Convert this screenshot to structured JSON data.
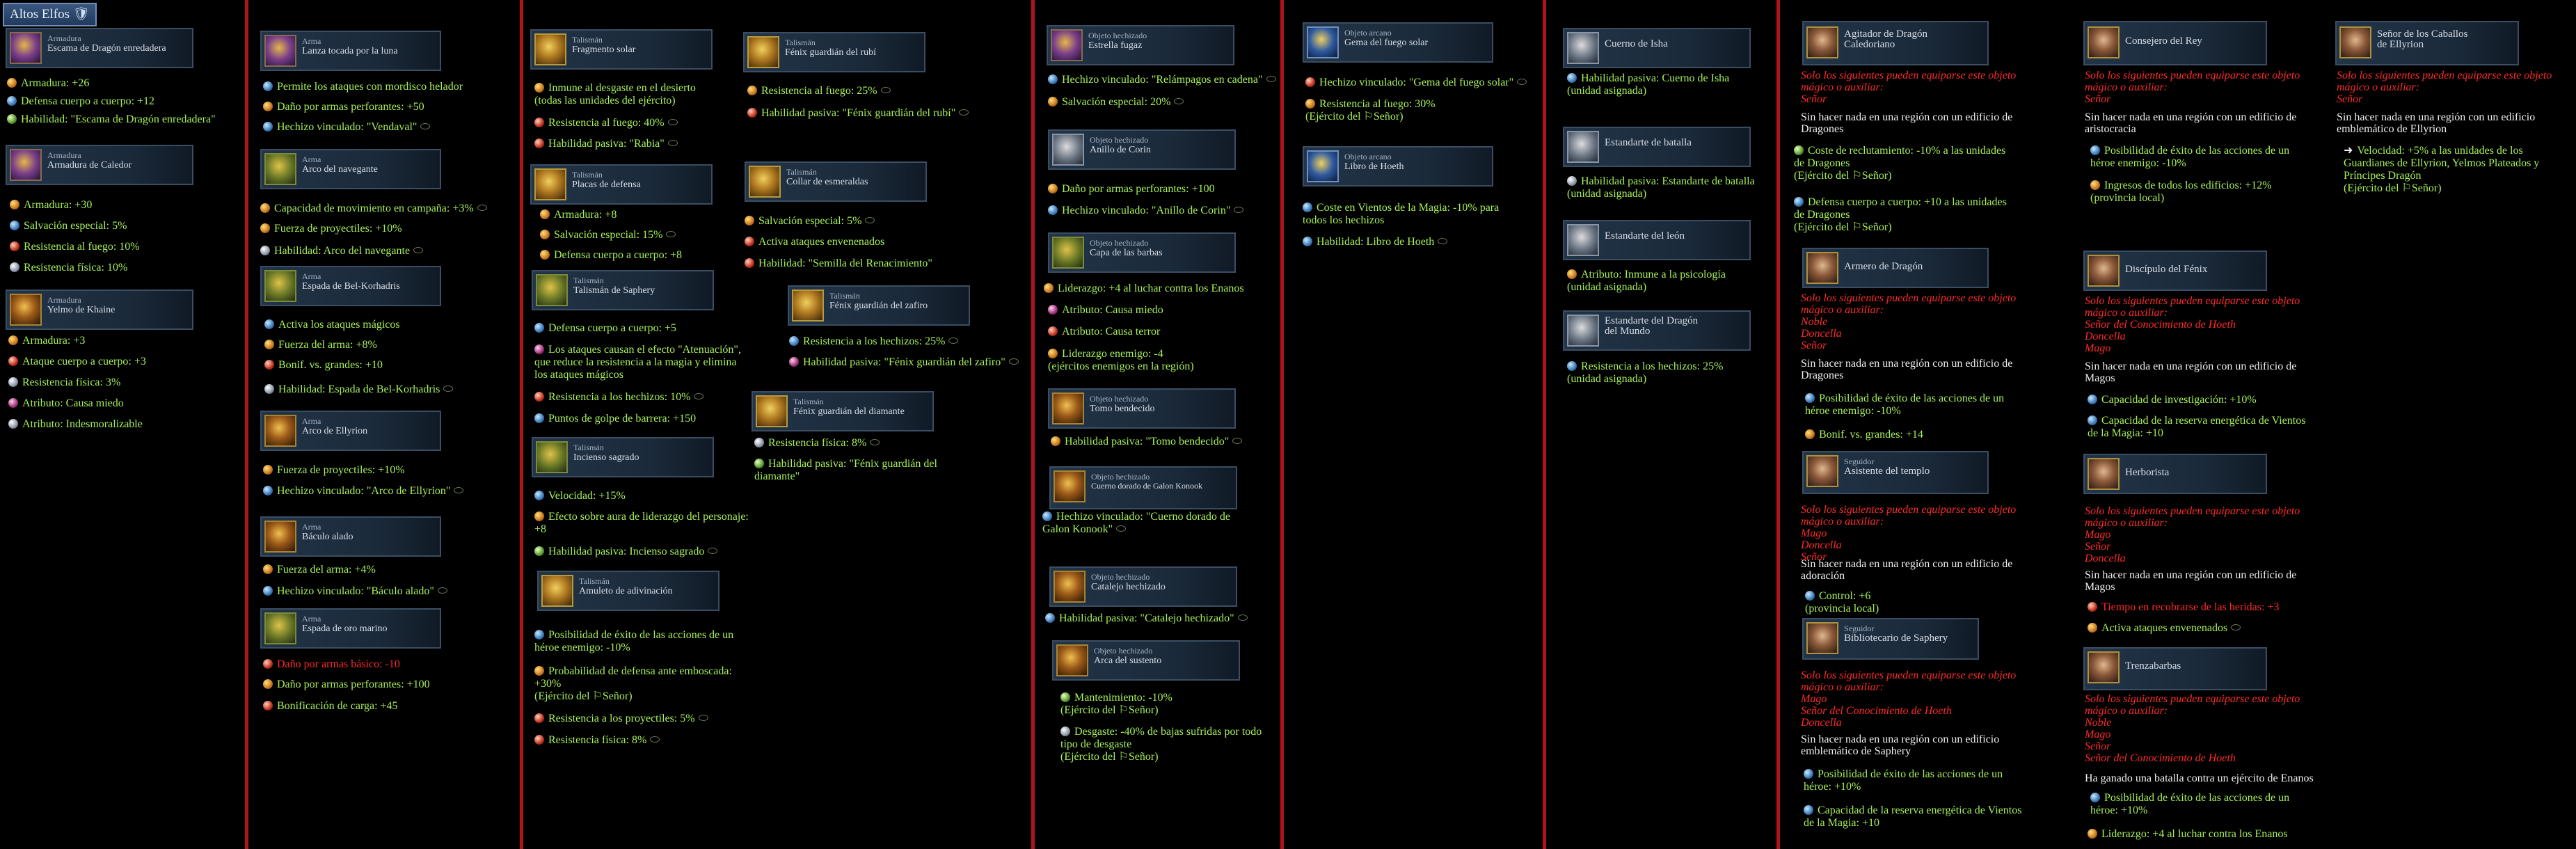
{
  "faction_tag": "Altos Elfos",
  "colors": {
    "stat": "#a7ef58",
    "negative": "#ff2a2a",
    "restriction": "#ff2a2a",
    "separator": "#b0141a",
    "card_bg": "#213448"
  },
  "col1": {
    "c1": {
      "kind": "Armadura",
      "name": "Escama de Dragón enredadera",
      "icon": "armor-icon"
    },
    "c1_s": [
      "Armadura: +26",
      "Defensa cuerpo a cuerpo: +12",
      "Habilidad: \"Escama de Dragón enredadera\""
    ],
    "c2": {
      "kind": "Armadura",
      "name": "Armadura de Caledor",
      "icon": "armor-icon"
    },
    "c2_s": [
      "Armadura: +30",
      "Salvación especial: 5%",
      "Resistencia al fuego: 10%",
      "Resistencia física: 10%"
    ],
    "c3": {
      "kind": "Armadura",
      "name": "Yelmo de Khaine",
      "icon": "helmet-icon"
    },
    "c3_s": [
      "Armadura: +3",
      "Ataque cuerpo a cuerpo: +3",
      "Resistencia física: 3%",
      "Atributo: Causa miedo",
      "Atributo: Indesmoralizable"
    ]
  },
  "col2": {
    "c1": {
      "kind": "Arma",
      "name": "Lanza tocada por la luna"
    },
    "c1_s": [
      "Permite los ataques con mordisco helador",
      "Daño por armas perforantes: +50",
      "Hechizo vinculado: \"Vendaval\""
    ],
    "c2": {
      "kind": "Arma",
      "name": "Arco del navegante"
    },
    "c2_s": [
      "Capacidad de movimiento en campaña: +3%",
      "Fuerza de proyectiles: +10%",
      "Habilidad: Arco del navegante"
    ],
    "c3": {
      "kind": "Arma",
      "name": "Espada de Bel-Korhadris"
    },
    "c3_s": [
      "Activa los ataques mágicos",
      "Fuerza del arma: +8%",
      "Bonif. vs. grandes: +10",
      "Habilidad: Espada de Bel-Korhadris"
    ],
    "c4": {
      "kind": "Arma",
      "name": "Arco de Ellyrion"
    },
    "c4_s": [
      "Fuerza de proyectiles: +10%",
      "Hechizo vinculado: \"Arco de Ellyrion\""
    ],
    "c5": {
      "kind": "Arma",
      "name": "Báculo alado"
    },
    "c5_s": [
      "Fuerza del arma: +4%",
      "Hechizo vinculado: \"Báculo alado\""
    ],
    "c6": {
      "kind": "Arma",
      "name": "Espada de oro marino"
    },
    "c6_s": [
      "Daño por armas básico: -10",
      "Daño por armas perforantes: +100",
      "Bonificación de carga: +45"
    ]
  },
  "col3": {
    "c1": {
      "kind": "Talismán",
      "name": "Fragmento solar"
    },
    "c1_s": [
      "Inmune al desgaste en el desierto\n(todas las unidades del ejército)",
      "Resistencia al fuego: 40%",
      "Habilidad pasiva: \"Rabia\""
    ],
    "c2": {
      "kind": "Talismán",
      "name": "Placas de defensa"
    },
    "c2_s": [
      "Armadura: +8",
      "Salvación especial: 15%",
      "Defensa cuerpo a cuerpo: +8"
    ],
    "c3": {
      "kind": "Talismán",
      "name": "Talismán de Saphery"
    },
    "c3_s": [
      "Defensa cuerpo a cuerpo: +5",
      "Los ataques causan el efecto \"Atenuación\",\nque reduce la resistencia a la magia y elimina\nlos ataques mágicos",
      "Resistencia a los hechizos: 10%",
      "Puntos de golpe de barrera: +150"
    ],
    "c4": {
      "kind": "Talismán",
      "name": "Incienso sagrado"
    },
    "c4_s": [
      "Velocidad: +15%",
      "Efecto sobre aura de liderazgo del personaje:\n+8",
      "Habilidad pasiva: Incienso sagrado"
    ],
    "c5": {
      "kind": "Talismán",
      "name": "Amuleto de adivinación"
    },
    "c5_s": [
      "Posibilidad de éxito de las acciones de un\nhéroe enemigo: -10%",
      "Probabilidad de defensa ante emboscada:\n+30%\n(Ejército del ⚐Señor)",
      "Resistencia a los proyectiles: 5%",
      "Resistencia física: 8%"
    ],
    "c6": {
      "kind": "Talismán",
      "name": "Fénix guardián del rubí"
    },
    "c6_s": [
      "Resistencia al fuego: 25%",
      "Habilidad pasiva: \"Fénix guardián del rubí\""
    ],
    "c7": {
      "kind": "Talismán",
      "name": "Collar de esmeraldas"
    },
    "c7_s": [
      "Salvación especial: 5%",
      "Activa ataques envenenados",
      "Habilidad: \"Semilla del Renacimiento\""
    ],
    "c8": {
      "kind": "Talismán",
      "name": "Fénix guardián del zafiro"
    },
    "c8_s": [
      "Resistencia a los hechizos: 25%",
      "Habilidad pasiva: \"Fénix guardián del zafiro\""
    ],
    "c9": {
      "kind": "Talismán",
      "name": "Fénix guardián del diamante"
    },
    "c9_s": [
      "Resistencia física: 8%",
      "Habilidad pasiva: \"Fénix guardián del\ndiamante\""
    ]
  },
  "col4": {
    "c1": {
      "kind": "Objeto hechizado",
      "name": "Estrella fugaz"
    },
    "c1_s": [
      "Hechizo vinculado: \"Relámpagos en cadena\"",
      "Salvación especial: 20%"
    ],
    "c2": {
      "kind": "Objeto hechizado",
      "name": "Anillo de Corin"
    },
    "c2_s": [
      "Daño por armas perforantes: +100",
      "Hechizo vinculado: \"Anillo de Corin\""
    ],
    "c3": {
      "kind": "Objeto hechizado",
      "name": "Capa de las barbas"
    },
    "c3_s": [
      "Liderazgo: +4 al luchar contra los Enanos",
      "Atributo: Causa miedo",
      "Atributo: Causa terror",
      "Liderazgo enemigo: -4\n(ejércitos enemigos en la región)"
    ],
    "c4": {
      "kind": "Objeto hechizado",
      "name": "Tomo bendecido"
    },
    "c4_s": [
      "Habilidad pasiva: \"Tomo bendecido\""
    ],
    "c5": {
      "kind": "Objeto hechizado",
      "name": "Cuerno dorado de Galon Konook"
    },
    "c5_s": [
      "Hechizo vinculado: \"Cuerno dorado de\nGalon Konook\""
    ],
    "c6": {
      "kind": "Objeto hechizado",
      "name": "Catalejo hechizado"
    },
    "c6_s": [
      "Habilidad pasiva: \"Catalejo hechizado\""
    ],
    "c7": {
      "kind": "Objeto hechizado",
      "name": "Arca del sustento"
    },
    "c7_s": [
      "Mantenimiento: -10%\n(Ejército del ⚐Señor)",
      "Desgaste: -40% de bajas sufridas por todo\ntipo de desgaste\n(Ejército del ⚐Señor)"
    ]
  },
  "col5": {
    "c1": {
      "kind": "Objeto arcano",
      "name": "Gema del fuego solar"
    },
    "c1_s": [
      "Hechizo vinculado: \"Gema del fuego solar\"",
      "Resistencia al fuego: 30%\n(Ejército del ⚐Señor)"
    ],
    "c2": {
      "kind": "Objeto arcano",
      "name": "Libro de Hoeth"
    },
    "c2_s": [
      "Coste en Vientos de la Magia: -10% para\ntodos los hechizos",
      "Habilidad: Libro de Hoeth"
    ]
  },
  "col6": {
    "c1": {
      "name": "Cuerno de Isha"
    },
    "c1_s": [
      "Habilidad pasiva: Cuerno de Isha\n(unidad asignada)"
    ],
    "c2": {
      "name": "Estandarte de batalla"
    },
    "c2_s": [
      "Habilidad pasiva: Estandarte de batalla\n(unidad asignada)"
    ],
    "c3": {
      "name": "Estandarte del león"
    },
    "c3_s": [
      "Atributo: Inmune a la psicología\n(unidad asignada)"
    ],
    "c4": {
      "name": "Estandarte del Dragón\ndel Mundo"
    },
    "c4_s": [
      "Resistencia a los hechizos: 25%\n(unidad asignada)"
    ]
  },
  "col7": {
    "c1": {
      "name": "Agitador de Dragón\nCaledoriano"
    },
    "c1_r": "Solo los siguientes pueden equiparse este objeto\nmágico o auxiliar:\nSeñor",
    "c1_w": "Sin hacer nada en una región con un edificio de\nDragones",
    "c1_s": [
      "Coste de reclutamiento: -10% a las unidades\nde Dragones\n(Ejército del ⚐Señor)",
      "Defensa cuerpo a cuerpo: +10 a las unidades\nde Dragones\n(Ejército del ⚐Señor)"
    ],
    "c2": {
      "name": "Armero de Dragón"
    },
    "c2_r": "Solo los siguientes pueden equiparse este objeto\nmágico o auxiliar:\nNoble\nDoncella\nSeñor",
    "c2_w": "Sin hacer nada en una región con un edificio de\nDragones",
    "c2_s": [
      "Posibilidad de éxito de las acciones de un\nhéroe enemigo: -10%",
      "Bonif. vs. grandes: +14"
    ],
    "c3": {
      "kind": "Seguidor",
      "name": "Asistente del templo"
    },
    "c3_r": "Solo los siguientes pueden equiparse este objeto\nmágico o auxiliar:\nMago\nDoncella\nSeñor",
    "c3_w": "Sin hacer nada en una región con un edificio de\nadoración",
    "c3_s": [
      "Control: +6\n(provincia local)"
    ],
    "c4": {
      "kind": "Seguidor",
      "name": "Bibliotecario de Saphery"
    },
    "c4_r": "Solo los siguientes pueden equiparse este objeto\nmágico o auxiliar:\nMago\nSeñor del Conocimiento de Hoeth\nDoncella",
    "c4_w": "Sin hacer nada en una región con un edificio\nemblemático de Saphery",
    "c4_s": [
      "Posibilidad de éxito de las acciones de un\nhéroe: +10%",
      "Capacidad de la reserva energética de Vientos\nde la Magia: +10"
    ]
  },
  "col8": {
    "c1": {
      "name": "Consejero del Rey"
    },
    "c1_r": "Solo los siguientes pueden equiparse este objeto\nmágico o auxiliar:\nSeñor",
    "c1_w": "Sin hacer nada en una región con un edificio de\naristocracia",
    "c1_s": [
      "Posibilidad de éxito de las acciones de un\nhéroe enemigo: -10%",
      "Ingresos de todos los edificios: +12%\n(provincia local)"
    ],
    "c2": {
      "name": "Discípulo del Fénix"
    },
    "c2_r": "Solo los siguientes pueden equiparse este objeto\nmágico o auxiliar:\nSeñor del Conocimiento de Hoeth\nDoncella\nMago",
    "c2_w": "Sin hacer nada en una región con un edificio de\nMagos",
    "c2_s": [
      "Capacidad de investigación: +10%",
      "Capacidad de la reserva energética de Vientos\nde la Magia: +10"
    ],
    "c3": {
      "name": "Herborista"
    },
    "c3_r": "Solo los siguientes pueden equiparse este objeto\nmágico o auxiliar:\nMago\nSeñor\nDoncella",
    "c3_w": "Sin hacer nada en una región con un edificio de\nMagos",
    "c3_s": [
      "Tiempo en recobrarse de las heridas: +3",
      "Activa ataques envenenados"
    ],
    "c4": {
      "name": "Trenzabarbas"
    },
    "c4_r": "Solo los siguientes pueden equiparse este objeto\nmágico o auxiliar:\nNoble\nMago\nSeñor\nSeñor del Conocimiento de Hoeth",
    "c4_w": "Ha ganado una batalla contra un ejército de Enanos",
    "c4_s": [
      "Posibilidad de éxito de las acciones de un\nhéroe: +10%",
      "Liderazgo: +4 al luchar contra los Enanos"
    ]
  },
  "col9": {
    "c1": {
      "name": "Señor de los Caballos\nde Ellyrion"
    },
    "c1_r": "Solo los siguientes pueden equiparse este objeto\nmágico o auxiliar:\nSeñor",
    "c1_w": "Sin hacer nada en una región con un edificio\nemblemático de Ellyrion",
    "c1_s": [
      "Velocidad: +5% a las unidades de los\nGuardianes de Ellyrion, Yelmos Plateados y\nPríncipes Dragón\n(Ejército del ⚐Señor)"
    ]
  }
}
